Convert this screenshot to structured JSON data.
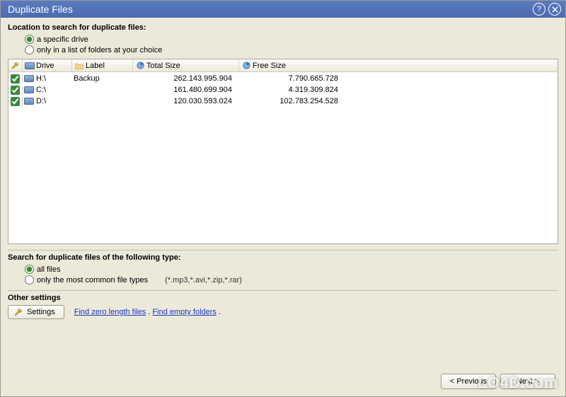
{
  "window": {
    "title": "Duplicate Files"
  },
  "location_section": {
    "heading": "Location to search for duplicate files:",
    "radios": {
      "specific_drive": "a specific drive",
      "folder_list": "only in a list of folders at your choice"
    }
  },
  "drive_table": {
    "headers": {
      "drive": "Drive",
      "label": "Label",
      "total": "Total Size",
      "free": "Free Size"
    },
    "rows": [
      {
        "drive": "H:\\",
        "label": "Backup",
        "total": "262.143.995.904",
        "free": "7.790.665.728"
      },
      {
        "drive": "C:\\",
        "label": "",
        "total": "161.480.699.904",
        "free": "4.319.309.824"
      },
      {
        "drive": "D:\\",
        "label": "",
        "total": "120.030.593.024",
        "free": "102.783.254.528"
      }
    ]
  },
  "type_section": {
    "heading": "Search for duplicate files of the following type:",
    "radios": {
      "all": "all files",
      "common": "only the most common file types"
    },
    "example": "(*.mp3,*.avi,*.zip,*.rar)"
  },
  "other_section": {
    "heading": "Other settings",
    "settings_btn": "Settings",
    "link_zero": "Find zero length files",
    "link_empty": "Find empty folders"
  },
  "footer": {
    "prev": "< Previous",
    "next": "Next >"
  },
  "watermark": "LO4D.com"
}
